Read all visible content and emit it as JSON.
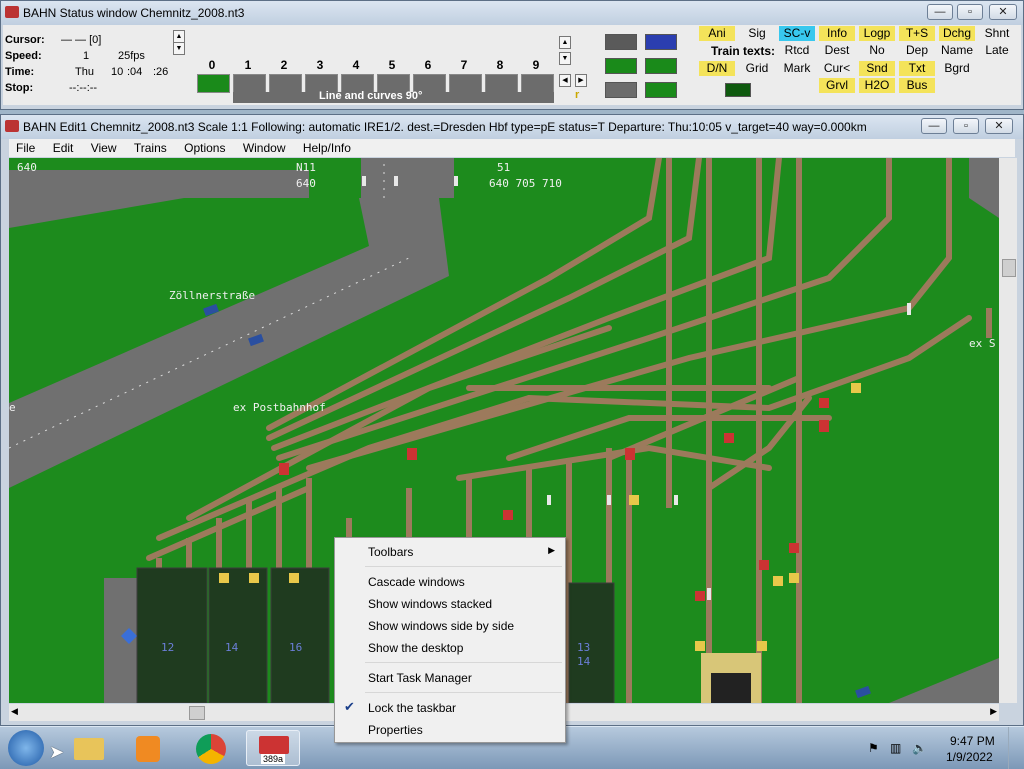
{
  "status_window": {
    "title": "BAHN Status window Chemnitz_2008.nt3",
    "labels": {
      "cursor": "Cursor:",
      "speed": "Speed:",
      "time": "Time:",
      "stop": "Stop:"
    },
    "values": {
      "cursor": "— —  [0]",
      "speed_a": "1",
      "speed_b": "25fps",
      "time_day": "Thu",
      "time_h": "10",
      "time_m": ":04",
      "time_s": ":26",
      "stop": "--:--:--"
    },
    "line_codes": [
      "0",
      "1",
      "2",
      "3",
      "4",
      "5",
      "6",
      "7",
      "8",
      "9"
    ],
    "line_caption": "Line and curves 90°",
    "r_label": "r",
    "toggles": [
      "Ani",
      "Sig",
      "SC-v",
      "Info",
      "Logp",
      "T+S",
      "Dchg",
      "Shnt"
    ],
    "train_texts_label": "Train texts:",
    "row2": [
      "Rtcd",
      "Dest",
      "No",
      "Dep",
      "Name",
      "Late"
    ],
    "row3": [
      "D/N",
      "Grid",
      "Mark",
      "Cur<",
      "Snd",
      "Txt",
      "Bgrd"
    ],
    "row4": [
      "Grvl",
      "H2O",
      "Bus"
    ]
  },
  "editor_window": {
    "title": "BAHN Edit1 Chemnitz_2008.nt3 Scale 1:1 Following: automatic IRE1/2.  dest.=Dresden Hbf type=pE status=T  Departure: Thu:10:05 v_target=40 way=0.000km",
    "menu": [
      "File",
      "Edit",
      "View",
      "Trains",
      "Options",
      "Window",
      "Help/Info"
    ]
  },
  "map_labels": {
    "l640": "640",
    "n11": "N11",
    "n11_640": "640",
    "l51": "51",
    "l640705710": "640 705 710",
    "zoellner": "Zöllnerstraße",
    "postbahnhof": "ex Postbahnhof",
    "e_left": "e",
    "ex_s": "ex S",
    "p12": "12",
    "p14": "14",
    "p16": "16",
    "p13": "13",
    "p14b": "14"
  },
  "context_menu": {
    "toolbars": "Toolbars",
    "cascade": "Cascade windows",
    "stacked": "Show windows stacked",
    "side": "Show windows side by side",
    "desktop": "Show the desktop",
    "task_manager": "Start Task Manager",
    "lock": "Lock the taskbar",
    "properties": "Properties"
  },
  "taskbar": {
    "clock_time": "9:47 PM",
    "clock_date": "1/9/2022",
    "bahn_badge": "389a"
  },
  "colors": {
    "field_green": "#1d8b1d",
    "road_gray": "#707070",
    "track_brown": "#9c7a5c",
    "toggle_yellow": "#f4e35a",
    "toggle_cyan": "#38c8ee"
  }
}
